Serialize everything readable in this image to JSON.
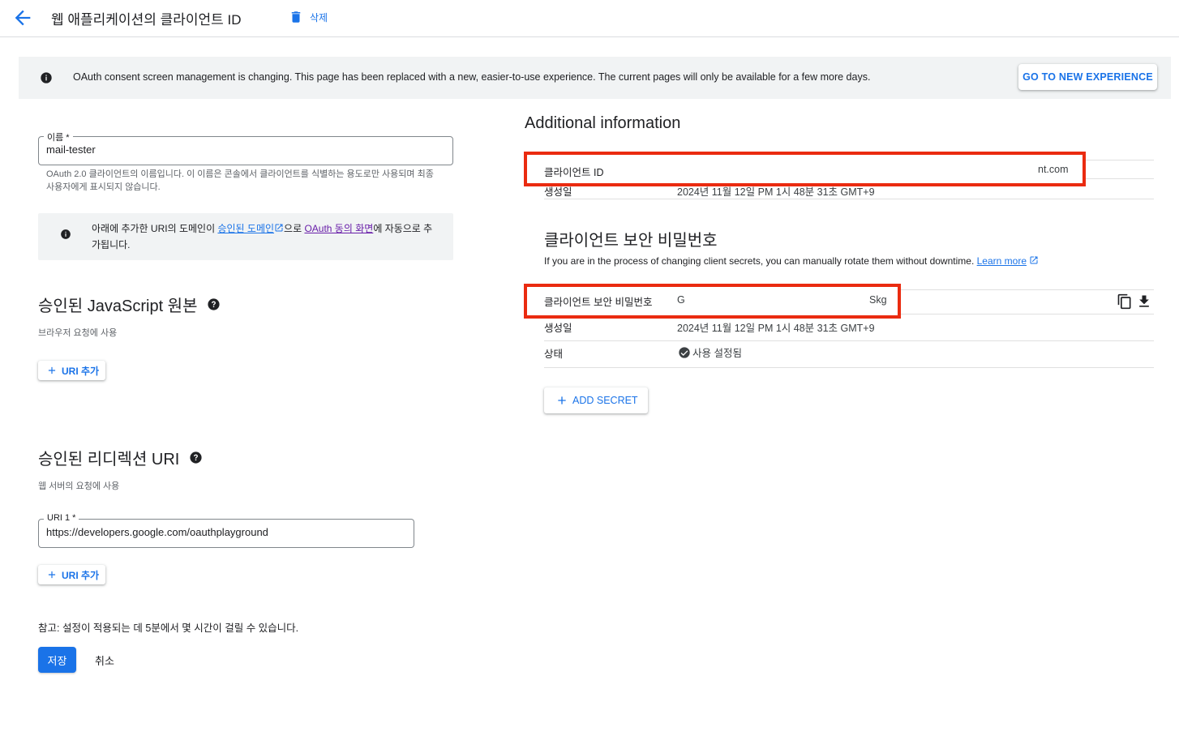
{
  "header": {
    "title": "웹 애플리케이션의 클라이언트 ID",
    "delete_label": "삭제"
  },
  "banner": {
    "message": "OAuth consent screen management is changing. This page has been replaced with a new, easier-to-use experience. The current pages will only be available for a few more days.",
    "button_label": "GO TO NEW EXPERIENCE"
  },
  "name_field": {
    "label": "이름 *",
    "value": "mail-tester",
    "hint": "OAuth 2.0 클라이언트의 이름입니다. 이 이름은 콘솔에서 클라이언트를 식별하는 용도로만 사용되며 최종 사용자에게 표시되지 않습니다."
  },
  "domain_note": {
    "prefix": "아래에 추가한 URI의 도메인이 ",
    "link1": "승인된 도메인",
    "middle": "으로 ",
    "link2": "OAuth 동의 화면",
    "suffix": "에 자동으로 추가됩니다."
  },
  "js_origins": {
    "title": "승인된 JavaScript 원본",
    "subtitle": "브라우저 요청에 사용",
    "add_label": "URI 추가"
  },
  "redirect_uris": {
    "title": "승인된 리디렉션 URI",
    "subtitle": "웹 서버의 요청에 사용",
    "uri1_label": "URI 1 *",
    "uri1_value": "https://developers.google.com/oauthplayground",
    "add_label": "URI 추가"
  },
  "footer": {
    "note": "참고: 설정이 적용되는 데 5분에서 몇 시간이 걸릴 수 있습니다.",
    "save_label": "저장",
    "cancel_label": "취소"
  },
  "additional": {
    "title": "Additional information",
    "client_id_label": "클라이언트 ID",
    "client_id_value": "nt.com",
    "created_label": "생성일",
    "created_value": "2024년 11월 12일 PM 1시 48분 31초 GMT+9"
  },
  "secrets": {
    "title": "클라이언트 보안 비밀번호",
    "description": "If you are in the process of changing client secrets, you can manually rotate them without downtime.",
    "learn_more": "Learn more",
    "secret_label": "클라이언트 보안 비밀번호",
    "secret_value_start": "G",
    "secret_value_end": "Skg",
    "created_label": "생성일",
    "created_value": "2024년 11월 12일 PM 1시 48분 31초 GMT+9",
    "status_label": "상태",
    "status_value": "사용 설정됨",
    "add_secret_label": "ADD SECRET"
  },
  "colors": {
    "accent": "#1a73e8",
    "highlight_box": "#ea2b10",
    "visited_link": "#681da8"
  },
  "icons": [
    "arrow-back-icon",
    "trash-icon",
    "info-icon",
    "help-icon",
    "plus-icon",
    "external-link-icon",
    "copy-icon",
    "download-icon",
    "check-circle-icon"
  ]
}
